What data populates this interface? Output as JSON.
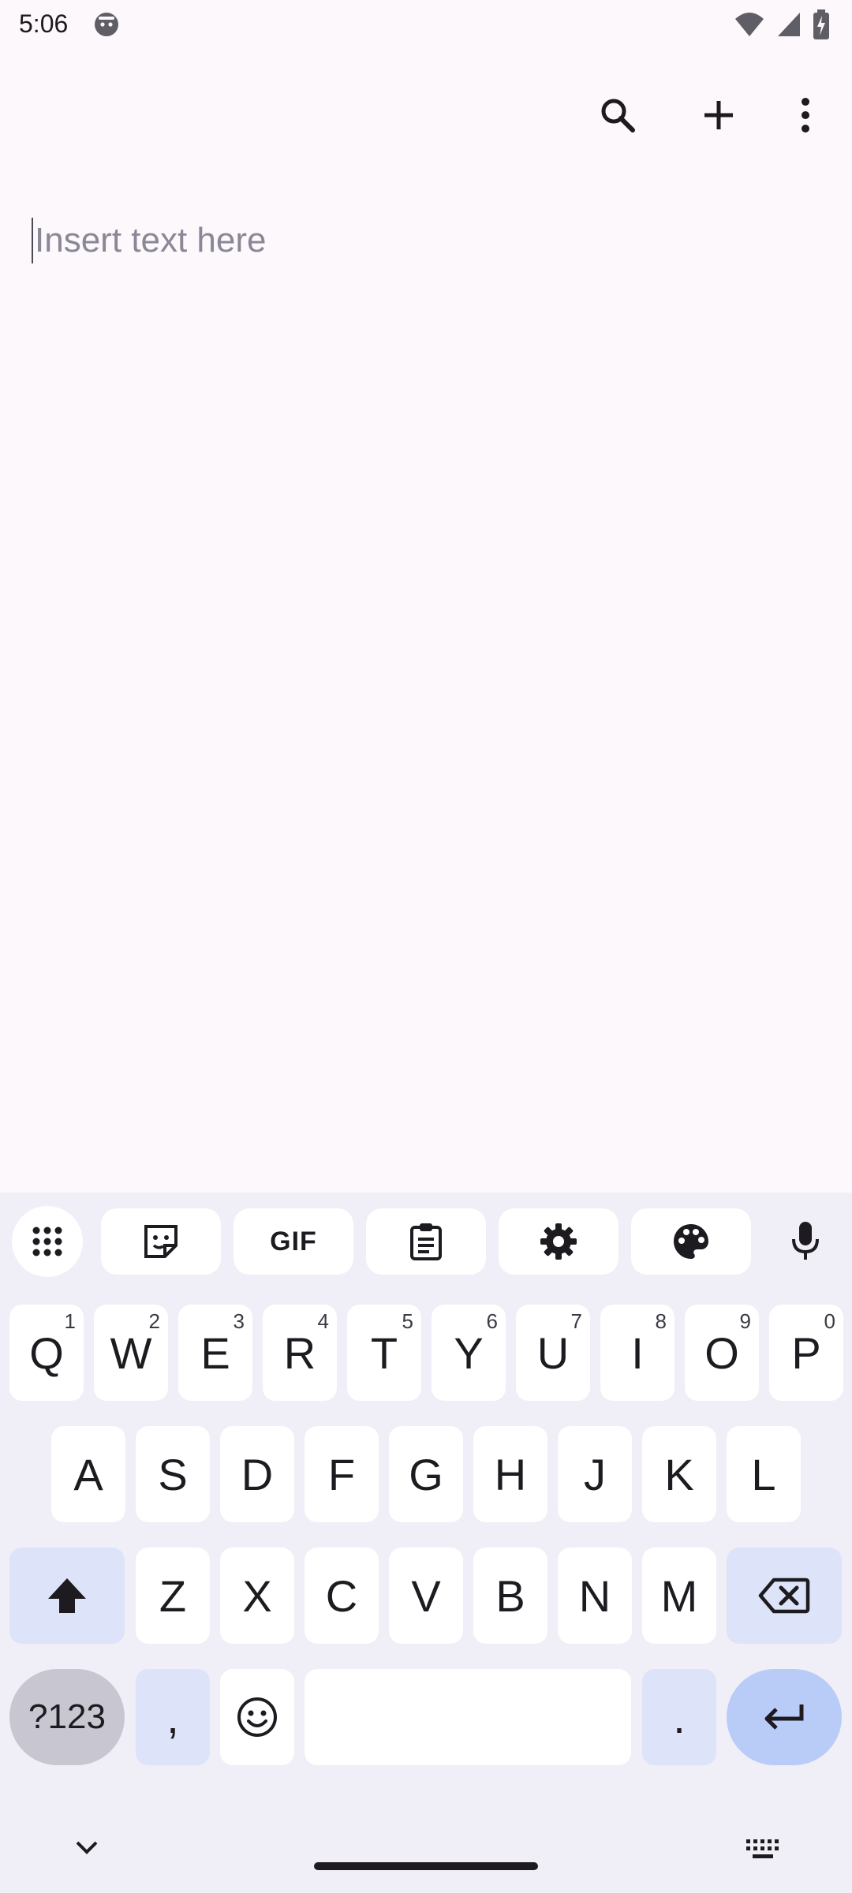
{
  "status": {
    "time": "5:06"
  },
  "app_bar": {
    "icons": [
      "search-icon",
      "add-icon",
      "more-vert-icon"
    ]
  },
  "editor": {
    "placeholder": "Insert text here",
    "value": ""
  },
  "keyboard": {
    "toolbar": [
      "apps-grid-icon",
      "sticker-icon",
      "GIF",
      "clipboard-icon",
      "settings-icon",
      "palette-icon",
      "mic-icon"
    ],
    "row1": [
      {
        "label": "Q",
        "hint": "1"
      },
      {
        "label": "W",
        "hint": "2"
      },
      {
        "label": "E",
        "hint": "3"
      },
      {
        "label": "R",
        "hint": "4"
      },
      {
        "label": "T",
        "hint": "5"
      },
      {
        "label": "Y",
        "hint": "6"
      },
      {
        "label": "U",
        "hint": "7"
      },
      {
        "label": "I",
        "hint": "8"
      },
      {
        "label": "O",
        "hint": "9"
      },
      {
        "label": "P",
        "hint": "0"
      }
    ],
    "row2": [
      "A",
      "S",
      "D",
      "F",
      "G",
      "H",
      "J",
      "K",
      "L"
    ],
    "row3": [
      "Z",
      "X",
      "C",
      "V",
      "B",
      "N",
      "M"
    ],
    "row4": {
      "symbols": "?123",
      "comma": ",",
      "period": "."
    }
  },
  "colors": {
    "background": "#fdf8fc",
    "keyboard_bg": "#f0eef6",
    "key": "#ffffff",
    "key_blue": "#dde3f8",
    "key_accent": "#b9ccf8"
  }
}
